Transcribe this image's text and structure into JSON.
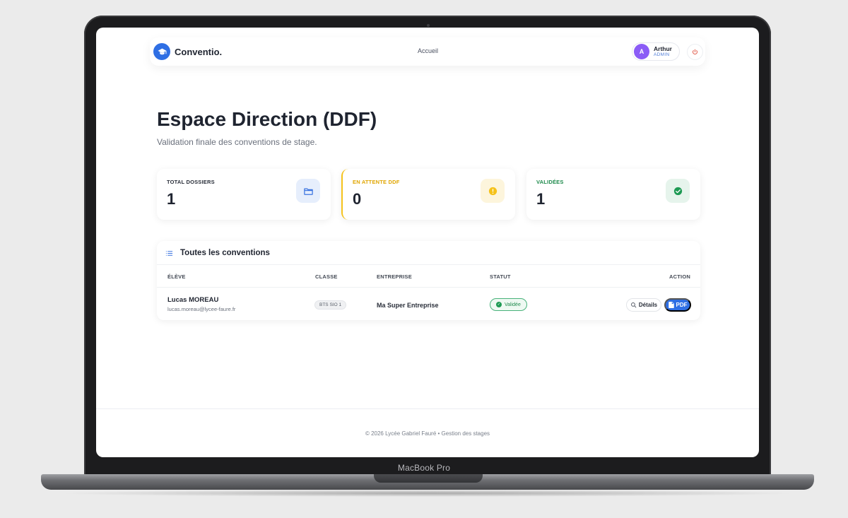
{
  "device": {
    "label": "MacBook Pro"
  },
  "navbar": {
    "brand": "Conventio.",
    "brand_icon": "graduation-cap-icon",
    "link_home": "Accueil",
    "user": {
      "initial": "A",
      "name": "Arthur",
      "role": "ADMIN"
    },
    "logout_icon": "power-icon"
  },
  "header": {
    "title": "Espace Direction (DDF)",
    "subtitle": "Validation finale des conventions de stage."
  },
  "stats": [
    {
      "label": "TOTAL DOSSIERS",
      "value": "1",
      "icon": "folder-icon",
      "color": "#3b74e0"
    },
    {
      "label": "EN ATTENTE DDF",
      "value": "0",
      "icon": "alert-icon",
      "color": "#f5c21b"
    },
    {
      "label": "VALIDÉES",
      "value": "1",
      "icon": "check-circle-icon",
      "color": "#1e8a4c"
    }
  ],
  "conventions": {
    "title": "Toutes les conventions",
    "columns": [
      "ÉLÈVE",
      "CLASSE",
      "ENTREPRISE",
      "STATUT",
      "ACTION"
    ],
    "rows": [
      {
        "name": "Lucas MOREAU",
        "email": "lucas.moreau@lycee-faure.fr",
        "class": "BTS SIO 1",
        "company": "Ma Super Entreprise",
        "status": "Validée",
        "details_label": "Détails",
        "pdf_label": "PDF"
      }
    ]
  },
  "footer": {
    "text": "© 2026 Lycée Gabriel Fauré • Gestion des stages"
  },
  "colors": {
    "primary": "#2f6fe4",
    "success": "#1e8a4c",
    "warning": "#f5c21b"
  }
}
